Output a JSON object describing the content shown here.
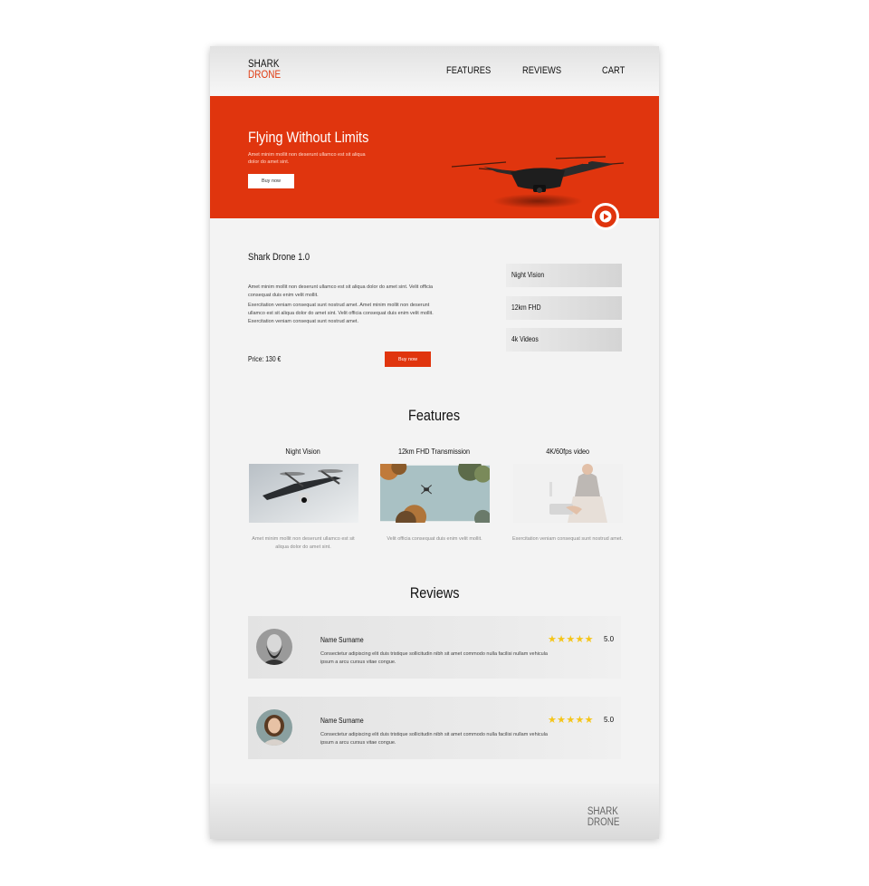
{
  "header": {
    "logo_line1": "SHARK",
    "logo_line2": "DRONE",
    "nav": [
      "FEATURES",
      "REVIEWS",
      "CART"
    ]
  },
  "hero": {
    "title": "Flying Without Limits",
    "subtitle": "Amet minim mollit non deserunt ullamco est sit aliqua dolor do amet sint.",
    "button": "Buy now"
  },
  "product": {
    "title": "Shark Drone 1.0",
    "desc1": "Amet minim mollit non deserunt ullamco est sit aliqua dolor do amet sint. Velit officia consequat duis enim velit mollit.",
    "desc2": "Exercitation veniam consequat sunt nostrud amet. Amet minim mollit non deserunt ullamco est sit aliqua dolor do amet sint. Velit officia consequat duis enim velit mollit. Exercitation veniam consequat sunt nostrud amet.",
    "price": "Price: 130 €",
    "button": "Buy now",
    "specs": [
      "Night Vision",
      "12km FHD",
      "4k Videos"
    ]
  },
  "features": {
    "heading": "Features",
    "items": [
      {
        "title": "Night Vision",
        "text": "Amet minim mollit non deserunt ullamco est sit aliqua dolor do amet sint."
      },
      {
        "title": "12km FHD Transmission",
        "text": "Velit officia consequat duis enim velit mollit."
      },
      {
        "title": "4K/60fps video",
        "text": "Exercitation veniam consequat sunt nostrud amet."
      }
    ]
  },
  "reviews": {
    "heading": "Reviews",
    "items": [
      {
        "name": "Name Surname",
        "text": "Consectetur adipiscing elit duis tristique sollicitudin nibh sit amet commodo nulla facilisi nullam vehicula ipsum a arcu cursus vitae congue.",
        "stars": "★★★★★",
        "rating": "5.0"
      },
      {
        "name": "Name Surname",
        "text": "Consectetur adipiscing elit duis tristique sollicitudin nibh sit amet commodo nulla facilisi nullam vehicula ipsum a arcu cursus vitae congue.",
        "stars": "★★★★★",
        "rating": "5.0"
      }
    ]
  },
  "footer": {
    "logo_line1": "SHARK",
    "logo_line2": "DRONE"
  },
  "colors": {
    "accent": "#e0350e",
    "star": "#f5c518",
    "background": "#f3f3f3"
  },
  "icons": [
    "play-icon",
    "drone-image",
    "star-icon"
  ]
}
